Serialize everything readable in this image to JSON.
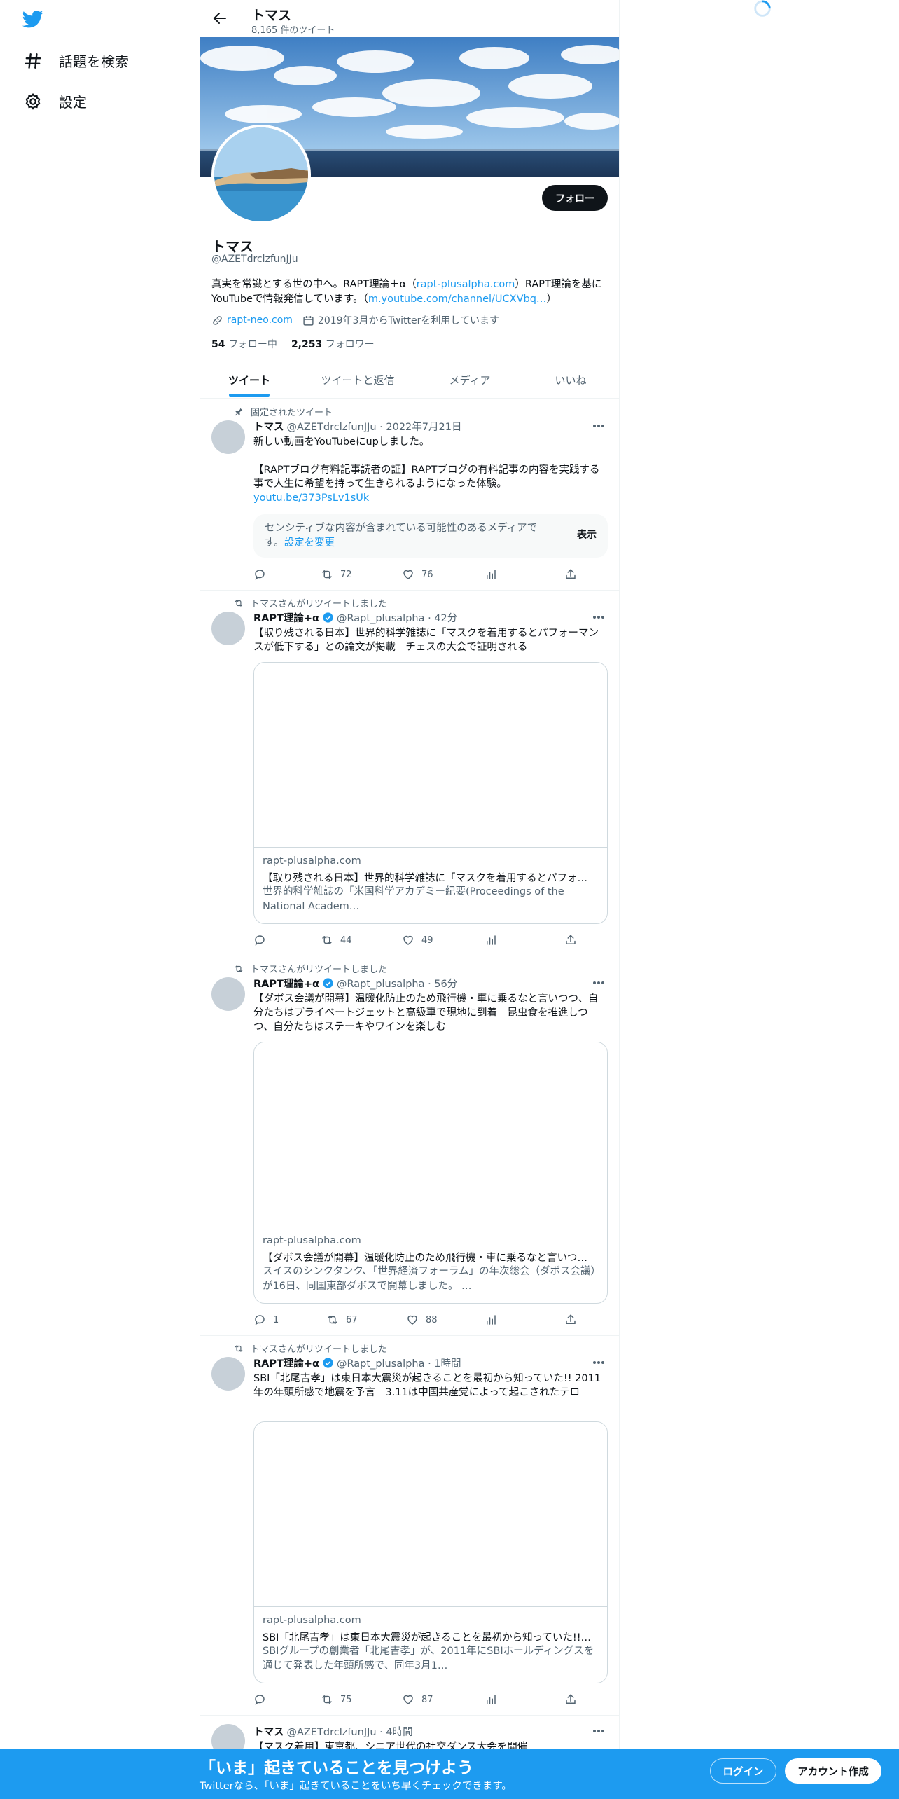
{
  "colors": {
    "accent": "#1d9bf0",
    "text": "#0f1419",
    "muted": "#536471",
    "border": "#eff3f4"
  },
  "nav": {
    "explore_label": "話題を検索",
    "settings_label": "設定"
  },
  "header": {
    "name": "トマス",
    "tweet_count": "8,165 件のツイート"
  },
  "profile": {
    "follow_label": "フォロー",
    "name": "トマス",
    "handle": "@AZETdrclzfunJJu",
    "bio_1": "真実を常識とする世の中へ。RAPT理論＋α（",
    "bio_link_1": "rapt-plusalpha.com",
    "bio_2": "）RAPT理論を基にYouTubeで情報発信しています。（",
    "bio_link_2": "m.youtube.com/channel/UCXVbq…",
    "bio_3": "）",
    "website": "rapt-neo.com",
    "joined": "2019年3月からTwitterを利用しています",
    "following_count": "54",
    "following_label": "フォロー中",
    "followers_count": "2,253",
    "followers_label": "フォロワー"
  },
  "tabs": [
    "ツイート",
    "ツイートと返信",
    "メディア",
    "いいね"
  ],
  "tweets": [
    {
      "context": "固定されたツイート",
      "name": "トマス",
      "handle": "@AZETdrclzfunJJu · 2022年7月21日",
      "text_1": "新しい動画をYouTubeにupしました。",
      "text_2": "【RAPTブログ有料記事読者の証】RAPTブログの有料記事の内容を実践する事で人生に希望を持って生きられるようになった体験。",
      "link": "youtu.be/373PsLv1sUk",
      "sensitive_text": "センシティブな内容が含まれている可能性のあるメディアです。",
      "sensitive_link": "設定を変更",
      "show_label": "表示",
      "replies": "",
      "retweets": "72",
      "likes": "76"
    },
    {
      "context": "トマスさんがリツイートしました",
      "name": "RAPT理論+α",
      "handle": "@Rapt_plusalpha · 42分",
      "text": "【取り残される日本】世界的科学雑誌に「マスクを着用するとパフォーマンスが低下する」との論文が掲載　チェスの大会で証明される",
      "card_domain": "rapt-plusalpha.com",
      "card_title": "【取り残される日本】世界的科学雑誌に「マスクを着用するとパフォ…",
      "card_desc": "世界的科学雑誌の「米国科学アカデミー紀要(Proceedings of the National Academ…",
      "replies": "",
      "retweets": "44",
      "likes": "49"
    },
    {
      "context": "トマスさんがリツイートしました",
      "name": "RAPT理論+α",
      "handle": "@Rapt_plusalpha · 56分",
      "text": "【ダボス会議が開幕】温暖化防止のため飛行機・車に乗るなと言いつつ、自分たちはプライベートジェットと高級車で現地に到着　昆虫食を推進しつつ、自分たちはステーキやワインを楽しむ",
      "card_domain": "rapt-plusalpha.com",
      "card_title": "【ダボス会議が開幕】温暖化防止のため飛行機・車に乗るなと言いつ…",
      "card_desc": "スイスのシンクタンク、「世界経済フォーラム」の年次総会（ダボス会議）が16日、同国東部ダボスで開幕しました。 …",
      "replies": "1",
      "retweets": "67",
      "likes": "88"
    },
    {
      "context": "トマスさんがリツイートしました",
      "name": "RAPT理論+α",
      "handle": "@Rapt_plusalpha · 1時間",
      "text": "SBI「北尾吉孝」は東日本大震災が起きることを最初から知っていた!! 2011年の年頭所感で地震を予言　3.11は中国共産党によって起こされたテロ",
      "card_domain": "rapt-plusalpha.com",
      "card_title": "SBI「北尾吉孝」は東日本大震災が起きることを最初から知っていた!!…",
      "card_desc": "SBIグループの創業者「北尾吉孝」が、2011年にSBIホールディングスを通じて発表した年頭所感で、同年3月1…",
      "replies": "",
      "retweets": "75",
      "likes": "87"
    },
    {
      "name": "トマス",
      "handle": "@AZETdrclzfunJJu · 4時間",
      "text": "【マスク着用】東京都、シニア世代の社交ダンス大会を開催"
    }
  ],
  "bottom_bar": {
    "title": "「いま」起きていることを見つけよう",
    "subtitle": "Twitterなら、「いま」起きていることをいち早くチェックできます。",
    "login_label": "ログイン",
    "signup_label": "アカウント作成"
  }
}
